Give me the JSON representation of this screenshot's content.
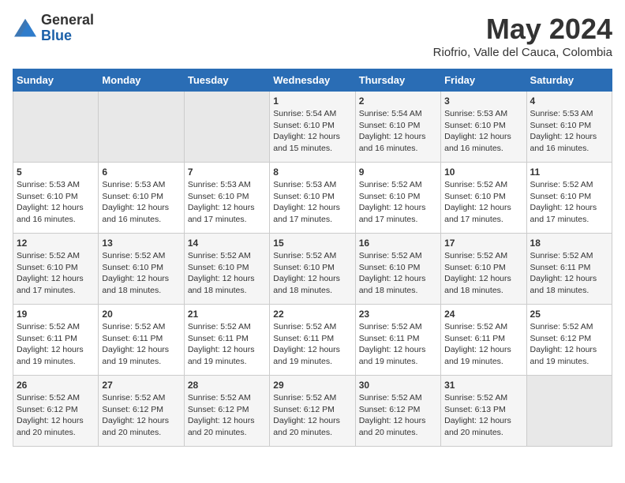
{
  "logo": {
    "general": "General",
    "blue": "Blue"
  },
  "header": {
    "month": "May 2024",
    "location": "Riofrio, Valle del Cauca, Colombia"
  },
  "weekdays": [
    "Sunday",
    "Monday",
    "Tuesday",
    "Wednesday",
    "Thursday",
    "Friday",
    "Saturday"
  ],
  "weeks": [
    [
      {
        "day": "",
        "empty": true
      },
      {
        "day": "",
        "empty": true
      },
      {
        "day": "",
        "empty": true
      },
      {
        "day": "1",
        "sunrise": "5:54 AM",
        "sunset": "6:10 PM",
        "daylight": "12 hours and 15 minutes."
      },
      {
        "day": "2",
        "sunrise": "5:54 AM",
        "sunset": "6:10 PM",
        "daylight": "12 hours and 16 minutes."
      },
      {
        "day": "3",
        "sunrise": "5:53 AM",
        "sunset": "6:10 PM",
        "daylight": "12 hours and 16 minutes."
      },
      {
        "day": "4",
        "sunrise": "5:53 AM",
        "sunset": "6:10 PM",
        "daylight": "12 hours and 16 minutes."
      }
    ],
    [
      {
        "day": "5",
        "sunrise": "5:53 AM",
        "sunset": "6:10 PM",
        "daylight": "12 hours and 16 minutes."
      },
      {
        "day": "6",
        "sunrise": "5:53 AM",
        "sunset": "6:10 PM",
        "daylight": "12 hours and 16 minutes."
      },
      {
        "day": "7",
        "sunrise": "5:53 AM",
        "sunset": "6:10 PM",
        "daylight": "12 hours and 17 minutes."
      },
      {
        "day": "8",
        "sunrise": "5:53 AM",
        "sunset": "6:10 PM",
        "daylight": "12 hours and 17 minutes."
      },
      {
        "day": "9",
        "sunrise": "5:52 AM",
        "sunset": "6:10 PM",
        "daylight": "12 hours and 17 minutes."
      },
      {
        "day": "10",
        "sunrise": "5:52 AM",
        "sunset": "6:10 PM",
        "daylight": "12 hours and 17 minutes."
      },
      {
        "day": "11",
        "sunrise": "5:52 AM",
        "sunset": "6:10 PM",
        "daylight": "12 hours and 17 minutes."
      }
    ],
    [
      {
        "day": "12",
        "sunrise": "5:52 AM",
        "sunset": "6:10 PM",
        "daylight": "12 hours and 17 minutes."
      },
      {
        "day": "13",
        "sunrise": "5:52 AM",
        "sunset": "6:10 PM",
        "daylight": "12 hours and 18 minutes."
      },
      {
        "day": "14",
        "sunrise": "5:52 AM",
        "sunset": "6:10 PM",
        "daylight": "12 hours and 18 minutes."
      },
      {
        "day": "15",
        "sunrise": "5:52 AM",
        "sunset": "6:10 PM",
        "daylight": "12 hours and 18 minutes."
      },
      {
        "day": "16",
        "sunrise": "5:52 AM",
        "sunset": "6:10 PM",
        "daylight": "12 hours and 18 minutes."
      },
      {
        "day": "17",
        "sunrise": "5:52 AM",
        "sunset": "6:10 PM",
        "daylight": "12 hours and 18 minutes."
      },
      {
        "day": "18",
        "sunrise": "5:52 AM",
        "sunset": "6:11 PM",
        "daylight": "12 hours and 18 minutes."
      }
    ],
    [
      {
        "day": "19",
        "sunrise": "5:52 AM",
        "sunset": "6:11 PM",
        "daylight": "12 hours and 19 minutes."
      },
      {
        "day": "20",
        "sunrise": "5:52 AM",
        "sunset": "6:11 PM",
        "daylight": "12 hours and 19 minutes."
      },
      {
        "day": "21",
        "sunrise": "5:52 AM",
        "sunset": "6:11 PM",
        "daylight": "12 hours and 19 minutes."
      },
      {
        "day": "22",
        "sunrise": "5:52 AM",
        "sunset": "6:11 PM",
        "daylight": "12 hours and 19 minutes."
      },
      {
        "day": "23",
        "sunrise": "5:52 AM",
        "sunset": "6:11 PM",
        "daylight": "12 hours and 19 minutes."
      },
      {
        "day": "24",
        "sunrise": "5:52 AM",
        "sunset": "6:11 PM",
        "daylight": "12 hours and 19 minutes."
      },
      {
        "day": "25",
        "sunrise": "5:52 AM",
        "sunset": "6:12 PM",
        "daylight": "12 hours and 19 minutes."
      }
    ],
    [
      {
        "day": "26",
        "sunrise": "5:52 AM",
        "sunset": "6:12 PM",
        "daylight": "12 hours and 20 minutes."
      },
      {
        "day": "27",
        "sunrise": "5:52 AM",
        "sunset": "6:12 PM",
        "daylight": "12 hours and 20 minutes."
      },
      {
        "day": "28",
        "sunrise": "5:52 AM",
        "sunset": "6:12 PM",
        "daylight": "12 hours and 20 minutes."
      },
      {
        "day": "29",
        "sunrise": "5:52 AM",
        "sunset": "6:12 PM",
        "daylight": "12 hours and 20 minutes."
      },
      {
        "day": "30",
        "sunrise": "5:52 AM",
        "sunset": "6:12 PM",
        "daylight": "12 hours and 20 minutes."
      },
      {
        "day": "31",
        "sunrise": "5:52 AM",
        "sunset": "6:13 PM",
        "daylight": "12 hours and 20 minutes."
      },
      {
        "day": "",
        "empty": true
      }
    ]
  ],
  "labels": {
    "sunrise": "Sunrise:",
    "sunset": "Sunset:",
    "daylight": "Daylight:"
  }
}
